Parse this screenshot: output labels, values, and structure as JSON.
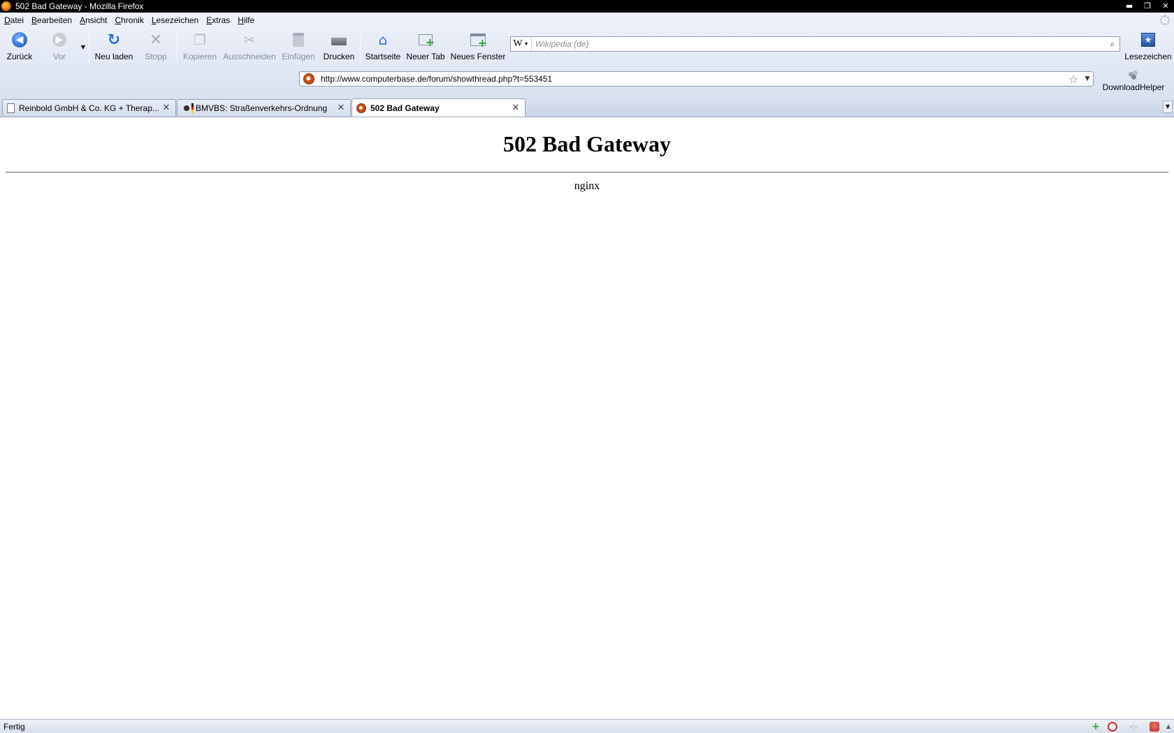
{
  "window": {
    "title": "502 Bad Gateway - Mozilla Firefox",
    "controls": {
      "minimize": "▬",
      "restore": "❐",
      "close": "✕"
    }
  },
  "menu": {
    "items": [
      "Datei",
      "Bearbeiten",
      "Ansicht",
      "Chronik",
      "Lesezeichen",
      "Extras",
      "Hilfe"
    ]
  },
  "toolbar": {
    "back": "Zurück",
    "forward": "Vor",
    "reload": "Neu laden",
    "stop": "Stopp",
    "copy": "Kopieren",
    "cut": "Ausschneiden",
    "paste": "Einfügen",
    "print": "Drucken",
    "home": "Startseite",
    "new_tab": "Neuer Tab",
    "new_window": "Neues Fenster",
    "bookmarks": "Lesezeichen",
    "downloadhelper": "DownloadHelper"
  },
  "search": {
    "engine_glyph": "W",
    "placeholder": "Wikipedia (de)"
  },
  "urlbar": {
    "url": "http://www.computerbase.de/forum/showthread.php?t=553451"
  },
  "tabs": [
    {
      "label": "Reinbold GmbH & Co. KG + Therap...",
      "selected": false
    },
    {
      "label": "BMVBS: Straßenverkehrs-Ordnung",
      "selected": false
    },
    {
      "label": "502 Bad Gateway",
      "selected": true
    }
  ],
  "content": {
    "heading": "502 Bad Gateway",
    "server": "nginx"
  },
  "status": {
    "text": "Fertig",
    "indicator": "-:-"
  },
  "colors": {
    "accent_blue": "#2f6fd6",
    "add_green": "#2aa52a",
    "titlebar": "#000000"
  }
}
